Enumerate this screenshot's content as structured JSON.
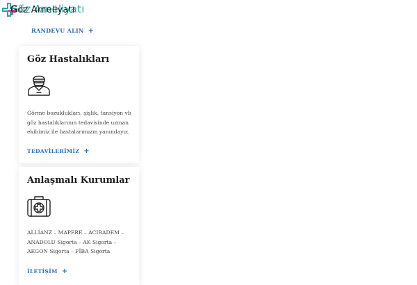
{
  "header": {
    "logo_text_overlay": "Göz Ameliyatı",
    "logo_text": "Göz Ameliyatı",
    "appointment_link": "RANDEVU ALIN",
    "plus_symbol": "+"
  },
  "cards": [
    {
      "title": "Göz Hastalıkları",
      "icon": "doctor-icon",
      "text": "Görme bozuklukları, şişlik, tansiyon vb göz hastalıklarının tedavisinde uzman ekibimiz ile hastalarımızın yanındayız.",
      "link": "TEDAVİLERİMİZ"
    },
    {
      "title": "Anlaşmalı Kurumlar",
      "icon": "medical-kit-icon",
      "text": "ALLİANZ – MAPFRE – ACIBADEM – ANADOLU Sigorta – AK Sigorta – AEGON Sigorta – FİBA Sigorta",
      "link": "İLETİŞİM"
    }
  ],
  "colors": {
    "accent": "#2e6fb7",
    "brand_teal": "#2aa5a8",
    "brand_magenta": "#d63384"
  }
}
